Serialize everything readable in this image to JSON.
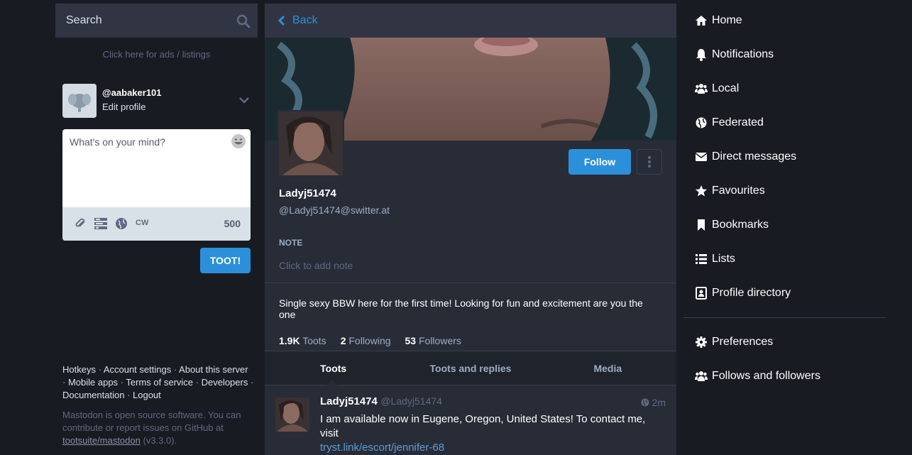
{
  "search": {
    "placeholder": "Search"
  },
  "ads_link": "Click here for ads / listings",
  "account": {
    "handle": "@aabaker101",
    "edit_label": "Edit profile"
  },
  "composer": {
    "placeholder": "What's on your mind?",
    "cw_label": "CW",
    "char_count": "500",
    "submit_label": "TOOT!"
  },
  "footer": {
    "links": [
      "Hotkeys",
      "Account settings",
      "About this server",
      "Mobile apps",
      "Terms of service",
      "Developers",
      "Documentation",
      "Logout"
    ],
    "about_prefix": "Mastodon is open source software. You can contribute or report issues on GitHub at",
    "repo_link": "tootsuite/mastodon",
    "version": "(v3.3.0)."
  },
  "column": {
    "back_label": "Back"
  },
  "profile": {
    "display_name": "Ladyj51474",
    "acct": "@Ladyj51474@switter.at",
    "follow_label": "Follow",
    "note_label": "NOTE",
    "note_placeholder": "Click to add note",
    "bio": "Single sexy BBW here for the first time! Looking for fun and excitement are you the one",
    "counts": [
      {
        "number": "1.9K",
        "label": "Toots"
      },
      {
        "number": "2",
        "label": "Following"
      },
      {
        "number": "53",
        "label": "Followers"
      }
    ]
  },
  "tabs": [
    "Toots",
    "Toots and replies",
    "Media"
  ],
  "status": {
    "display_name": "Ladyj51474",
    "handle": "@Ladyj51474",
    "time": "2m",
    "text": "I am available now in Eugene, Oregon, United States! To contact me, visit",
    "link": "tryst.link/escort/jennifer-68"
  },
  "nav": {
    "items": [
      {
        "label": "Home",
        "icon": "home-icon"
      },
      {
        "label": "Notifications",
        "icon": "bell-icon"
      },
      {
        "label": "Local",
        "icon": "users-icon"
      },
      {
        "label": "Federated",
        "icon": "globe-icon"
      },
      {
        "label": "Direct messages",
        "icon": "envelope-icon"
      },
      {
        "label": "Favourites",
        "icon": "star-icon"
      },
      {
        "label": "Bookmarks",
        "icon": "bookmark-icon"
      },
      {
        "label": "Lists",
        "icon": "list-icon"
      },
      {
        "label": "Profile directory",
        "icon": "address-book-icon"
      }
    ],
    "secondary": [
      {
        "label": "Preferences",
        "icon": "gear-icon"
      },
      {
        "label": "Follows and followers",
        "icon": "users-icon"
      }
    ]
  },
  "colors": {
    "accent": "#2b90d9",
    "background": "#191b22",
    "panel": "#282c37"
  }
}
